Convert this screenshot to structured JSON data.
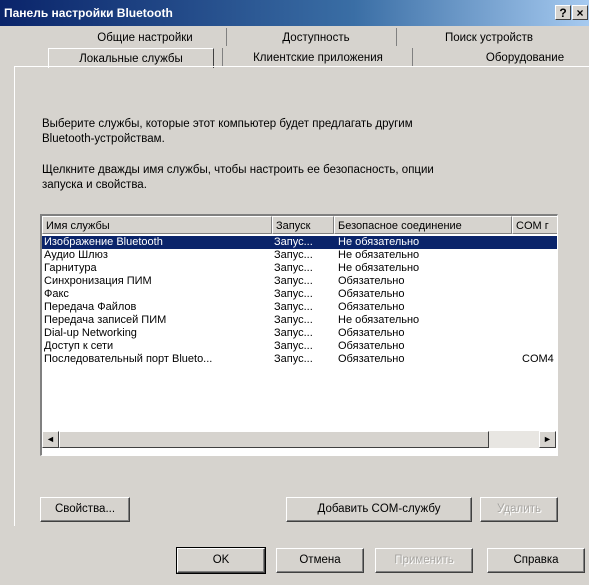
{
  "window": {
    "title": "Панель настройки Bluetooth",
    "help_btn": "?",
    "close_btn": "×"
  },
  "tabs": {
    "row1": [
      "Общие настройки",
      "Доступность",
      "Поиск устройств"
    ],
    "row2": [
      "Локальные службы",
      "Клиентские приложения",
      "Оборудование"
    ],
    "active": "Локальные службы"
  },
  "description": {
    "line1": "Выберите службы, которые этот компьютер будет предлагать другим",
    "line2": "Bluetooth-устройствам.",
    "line3": "Щелкните дважды имя службы, чтобы настроить ее безопасность, опции",
    "line4": "запуска и свойства."
  },
  "table": {
    "headers": [
      "Имя службы",
      "Запуск",
      "Безопасное соединение",
      "COM г"
    ],
    "rows": [
      [
        "Изображение Bluetooth",
        "Запус...",
        "Не обязательно",
        ""
      ],
      [
        "Аудио Шлюз",
        "Запус...",
        "Не обязательно",
        ""
      ],
      [
        "Гарнитура",
        "Запус...",
        "Не обязательно",
        ""
      ],
      [
        "Синхронизация ПИМ",
        "Запус...",
        "Обязательно",
        ""
      ],
      [
        "Факс",
        "Запус...",
        "Обязательно",
        ""
      ],
      [
        "Передача Файлов",
        "Запус...",
        "Обязательно",
        ""
      ],
      [
        "Передача записей ПИМ",
        "Запус...",
        "Не обязательно",
        ""
      ],
      [
        "Dial-up Networking",
        "Запус...",
        "Обязательно",
        ""
      ],
      [
        "Доступ к сети",
        "Запус...",
        "Обязательно",
        ""
      ],
      [
        "Последовательный порт Blueto...",
        "Запус...",
        "Обязательно",
        "COM4"
      ]
    ],
    "selected_row": 0
  },
  "scroll": {
    "left": "◄",
    "right": "►"
  },
  "buttons": {
    "properties": "Свойства...",
    "add_com": "Добавить COM-службу",
    "remove": "Удалить",
    "ok": "OK",
    "cancel": "Отмена",
    "apply": "Применить",
    "help": "Справка"
  }
}
